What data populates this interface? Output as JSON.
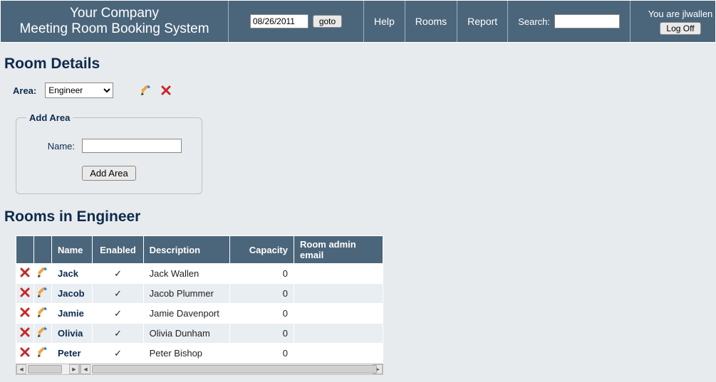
{
  "header": {
    "company": "Your Company",
    "system": "Meeting Room Booking System",
    "date_value": "08/26/2011",
    "goto_label": "goto",
    "nav": {
      "help": "Help",
      "rooms": "Rooms",
      "report": "Report"
    },
    "search_label": "Search:",
    "user_text": "You are jlwallen",
    "logoff_label": "Log Off"
  },
  "room_details": {
    "title": "Room Details",
    "area_label": "Area:",
    "area_selected": "Engineer"
  },
  "add_area": {
    "legend": "Add Area",
    "name_label": "Name:",
    "button_label": "Add Area"
  },
  "rooms_section": {
    "title": "Rooms in Engineer",
    "columns": {
      "name": "Name",
      "enabled": "Enabled",
      "description": "Description",
      "capacity": "Capacity",
      "admin_email": "Room admin email"
    },
    "rows": [
      {
        "name": "Jack",
        "enabled": "✓",
        "description": "Jack Wallen",
        "capacity": "0",
        "admin_email": ""
      },
      {
        "name": "Jacob",
        "enabled": "✓",
        "description": "Jacob Plummer",
        "capacity": "0",
        "admin_email": ""
      },
      {
        "name": "Jamie",
        "enabled": "✓",
        "description": "Jamie Davenport",
        "capacity": "0",
        "admin_email": ""
      },
      {
        "name": "Olivia",
        "enabled": "✓",
        "description": "Olivia Dunham",
        "capacity": "0",
        "admin_email": ""
      },
      {
        "name": "Peter",
        "enabled": "✓",
        "description": "Peter Bishop",
        "capacity": "0",
        "admin_email": ""
      }
    ]
  }
}
